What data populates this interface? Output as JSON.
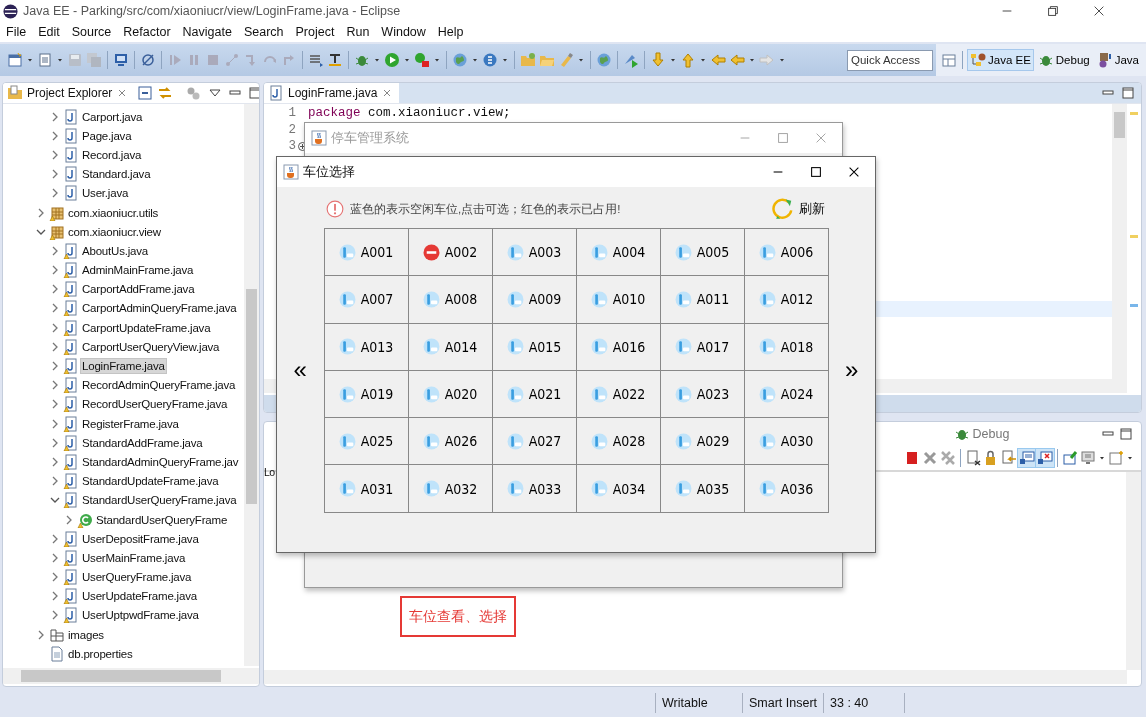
{
  "window": {
    "title": "Java EE - Parking/src/com/xiaoniucr/view/LoginFrame.java - Eclipse"
  },
  "menu": [
    "File",
    "Edit",
    "Source",
    "Refactor",
    "Navigate",
    "Search",
    "Project",
    "Run",
    "Window",
    "Help"
  ],
  "toolbar": {
    "quick_access": {
      "placeholder": "Quick Access"
    },
    "perspectives": [
      {
        "label": "Java EE",
        "selected": true
      },
      {
        "label": "Debug",
        "selected": false
      },
      {
        "label": "Java",
        "selected": false
      }
    ]
  },
  "project_explorer": {
    "title": "Project Explorer",
    "tree": [
      {
        "children": [
          {
            "label": "Carport.java",
            "kind": "java",
            "warning": false,
            "expanded": false,
            "selected": false
          },
          {
            "label": "Page.java",
            "kind": "java",
            "warning": false,
            "expanded": false,
            "selected": false
          },
          {
            "label": "Record.java",
            "kind": "java",
            "warning": false,
            "expanded": false,
            "selected": false
          },
          {
            "label": "Standard.java",
            "kind": "java",
            "warning": false,
            "expanded": false,
            "selected": false
          },
          {
            "label": "User.java",
            "kind": "java",
            "warning": false,
            "expanded": false,
            "selected": false
          }
        ]
      },
      {
        "label": "com.xiaoniucr.utils",
        "kind": "package",
        "warning": true,
        "expanded": false,
        "selected": false
      },
      {
        "label": "com.xiaoniucr.view",
        "kind": "package",
        "warning": true,
        "expanded": true,
        "selected": false,
        "children": [
          {
            "label": "AboutUs.java",
            "kind": "java",
            "warning": true,
            "expanded": false,
            "selected": false
          },
          {
            "label": "AdminMainFrame.java",
            "kind": "java",
            "warning": true,
            "expanded": false,
            "selected": false
          },
          {
            "label": "CarportAddFrame.java",
            "kind": "java",
            "warning": true,
            "expanded": false,
            "selected": false
          },
          {
            "label": "CarportAdminQueryFrame.java",
            "kind": "java",
            "warning": true,
            "expanded": false,
            "selected": false
          },
          {
            "label": "CarportUpdateFrame.java",
            "kind": "java",
            "warning": true,
            "expanded": false,
            "selected": false
          },
          {
            "label": "CarportUserQueryView.java",
            "kind": "java",
            "warning": true,
            "expanded": false,
            "selected": false
          },
          {
            "label": "LoginFrame.java",
            "kind": "java",
            "warning": true,
            "expanded": false,
            "selected": true
          },
          {
            "label": "RecordAdminQueryFrame.java",
            "kind": "java",
            "warning": true,
            "expanded": false,
            "selected": false
          },
          {
            "label": "RecordUserQueryFrame.java",
            "kind": "java",
            "warning": true,
            "expanded": false,
            "selected": false
          },
          {
            "label": "RegisterFrame.java",
            "kind": "java",
            "warning": true,
            "expanded": false,
            "selected": false
          },
          {
            "label": "StandardAddFrame.java",
            "kind": "java",
            "warning": true,
            "expanded": false,
            "selected": false
          },
          {
            "label": "StandardAdminQueryFrame.jav",
            "kind": "java",
            "warning": true,
            "expanded": false,
            "selected": false
          },
          {
            "label": "StandardUpdateFrame.java",
            "kind": "java",
            "warning": true,
            "expanded": false,
            "selected": false
          },
          {
            "label": "StandardUserQueryFrame.java",
            "kind": "java",
            "warning": true,
            "expanded": true,
            "selected": false,
            "children": [
              {
                "label": "StandardUserQueryFrame",
                "kind": "class",
                "warning": true,
                "expanded": false,
                "selected": false
              }
            ]
          },
          {
            "label": "UserDepositFrame.java",
            "kind": "java",
            "warning": true,
            "expanded": false,
            "selected": false
          },
          {
            "label": "UserMainFrame.java",
            "kind": "java",
            "warning": true,
            "expanded": false,
            "selected": false
          },
          {
            "label": "UserQueryFrame.java",
            "kind": "java",
            "warning": true,
            "expanded": false,
            "selected": false
          },
          {
            "label": "UserUpdateFrame.java",
            "kind": "java",
            "warning": true,
            "expanded": false,
            "selected": false
          },
          {
            "label": "UserUptpwdFrame.java",
            "kind": "java",
            "warning": true,
            "expanded": false,
            "selected": false
          }
        ]
      },
      {
        "label": "images",
        "kind": "folder",
        "warning": false,
        "expanded": false,
        "selected": false
      },
      {
        "label": "db.properties",
        "kind": "file",
        "warning": false,
        "selected": false
      }
    ]
  },
  "editor": {
    "tab": "LoginFrame.java",
    "lines": [
      {
        "number": "1",
        "keyword": "package",
        "code": "com.xiaoniucr.view;",
        "folded": false
      },
      {
        "number": "2",
        "folded": false
      },
      {
        "number": "3",
        "folded": true
      }
    ]
  },
  "bottom_panel": {
    "tab": "Debug",
    "console_text": "Lo"
  },
  "status_bar": [
    "Writable",
    "Smart Insert",
    "33 : 40"
  ],
  "back_dialog": {
    "title": "停车管理系统",
    "active": false
  },
  "dialog": {
    "title": "车位选择",
    "active": true,
    "hint": "蓝色的表示空闲车位,点击可选；红色的表示已占用!",
    "refresh": "刷新",
    "prev": "«",
    "next": "»",
    "slots": [
      {
        "label": "A001",
        "kind": "free"
      },
      {
        "label": "A002",
        "kind": "occupied"
      },
      {
        "label": "A003",
        "kind": "free"
      },
      {
        "label": "A004",
        "kind": "free"
      },
      {
        "label": "A005",
        "kind": "free"
      },
      {
        "label": "A006",
        "kind": "free"
      },
      {
        "label": "A007",
        "kind": "free"
      },
      {
        "label": "A008",
        "kind": "free"
      },
      {
        "label": "A009",
        "kind": "free"
      },
      {
        "label": "A010",
        "kind": "free"
      },
      {
        "label": "A011",
        "kind": "free"
      },
      {
        "label": "A012",
        "kind": "free"
      },
      {
        "label": "A013",
        "kind": "free"
      },
      {
        "label": "A014",
        "kind": "free"
      },
      {
        "label": "A015",
        "kind": "free"
      },
      {
        "label": "A016",
        "kind": "free"
      },
      {
        "label": "A017",
        "kind": "free"
      },
      {
        "label": "A018",
        "kind": "free"
      },
      {
        "label": "A019",
        "kind": "free"
      },
      {
        "label": "A020",
        "kind": "free"
      },
      {
        "label": "A021",
        "kind": "free"
      },
      {
        "label": "A022",
        "kind": "free"
      },
      {
        "label": "A023",
        "kind": "free"
      },
      {
        "label": "A024",
        "kind": "free"
      },
      {
        "label": "A025",
        "kind": "free"
      },
      {
        "label": "A026",
        "kind": "free"
      },
      {
        "label": "A027",
        "kind": "free"
      },
      {
        "label": "A028",
        "kind": "free"
      },
      {
        "label": "A029",
        "kind": "free"
      },
      {
        "label": "A030",
        "kind": "free"
      },
      {
        "label": "A031",
        "kind": "free"
      },
      {
        "label": "A032",
        "kind": "free"
      },
      {
        "label": "A033",
        "kind": "free"
      },
      {
        "label": "A034",
        "kind": "free"
      },
      {
        "label": "A035",
        "kind": "free"
      },
      {
        "label": "A036",
        "kind": "free"
      }
    ]
  },
  "annotation": "车位查看、选择"
}
